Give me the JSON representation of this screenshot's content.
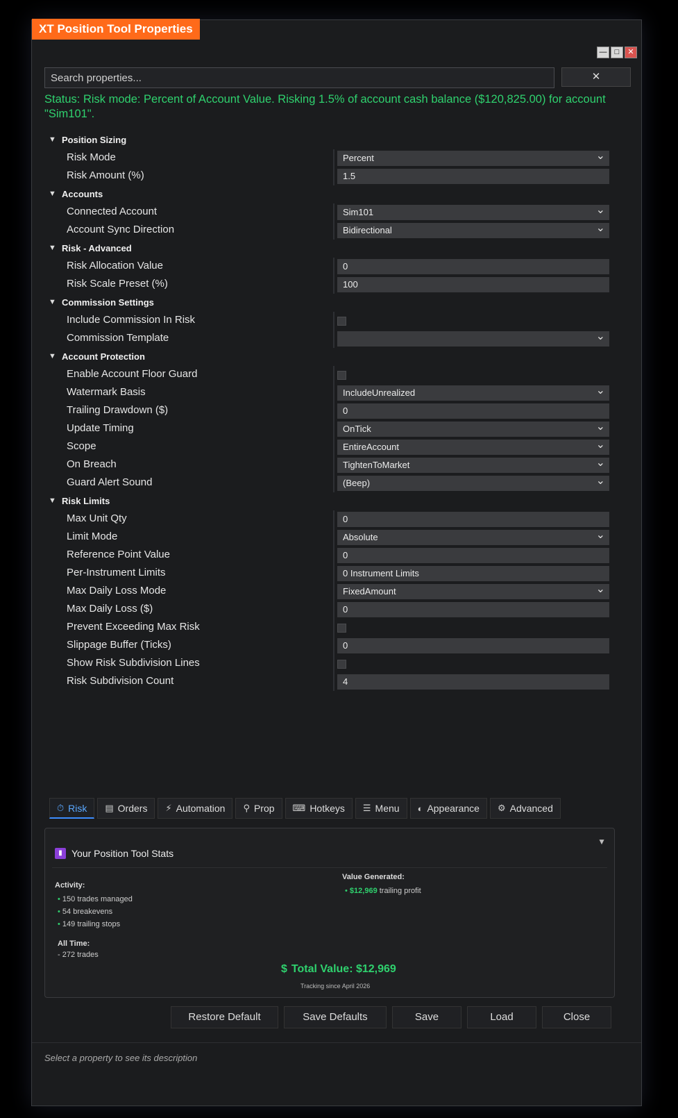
{
  "window": {
    "title": "XT Position Tool Properties",
    "controls": [
      "—",
      "□",
      "✕"
    ]
  },
  "search": {
    "placeholder": "Search properties...",
    "clear": "✕"
  },
  "status": "Status: Risk mode: Percent of Account Value. Risking 1.5% of account cash balance ($120,825.00) for account \"Sim101\".",
  "categories": [
    {
      "name": "Position Sizing",
      "props": [
        {
          "label": "Risk Mode",
          "value": "Percent",
          "kind": "dropdown"
        },
        {
          "label": "Risk Amount (%)",
          "value": "1.5",
          "kind": "text"
        }
      ]
    },
    {
      "name": "Accounts",
      "props": [
        {
          "label": "Connected Account",
          "value": "Sim101",
          "kind": "dropdown"
        },
        {
          "label": "Account Sync Direction",
          "value": "Bidirectional",
          "kind": "dropdown"
        }
      ]
    },
    {
      "name": "Risk - Advanced",
      "props": [
        {
          "label": "Risk Allocation Value",
          "value": "0",
          "kind": "text"
        },
        {
          "label": "Risk Scale Preset (%)",
          "value": "100",
          "kind": "text"
        }
      ]
    },
    {
      "name": "Commission Settings",
      "props": [
        {
          "label": "Include Commission In Risk",
          "value": "",
          "kind": "checkbox"
        },
        {
          "label": "Commission Template",
          "value": "",
          "kind": "dropdown"
        }
      ]
    },
    {
      "name": "Account Protection",
      "props": [
        {
          "label": "Enable Account Floor Guard",
          "value": "",
          "kind": "checkbox"
        },
        {
          "label": "Watermark Basis",
          "value": "IncludeUnrealized",
          "kind": "dropdown"
        },
        {
          "label": "Trailing Drawdown ($)",
          "value": "0",
          "kind": "text"
        },
        {
          "label": "Update Timing",
          "value": "OnTick",
          "kind": "dropdown"
        },
        {
          "label": "Scope",
          "value": "EntireAccount",
          "kind": "dropdown"
        },
        {
          "label": "On Breach",
          "value": "TightenToMarket",
          "kind": "dropdown"
        },
        {
          "label": "Guard Alert Sound",
          "value": "(Beep)",
          "kind": "dropdown"
        }
      ]
    },
    {
      "name": "Risk Limits",
      "props": [
        {
          "label": "Max Unit Qty",
          "value": "0",
          "kind": "text"
        },
        {
          "label": "Limit Mode",
          "value": "Absolute",
          "kind": "dropdown"
        },
        {
          "label": "Reference Point Value",
          "value": "0",
          "kind": "text"
        },
        {
          "label": "Per-Instrument Limits",
          "value": "0 Instrument Limits",
          "kind": "text"
        },
        {
          "label": "Max Daily Loss Mode",
          "value": "FixedAmount",
          "kind": "dropdown"
        },
        {
          "label": "Max Daily Loss ($)",
          "value": "0",
          "kind": "text"
        },
        {
          "label": "Prevent Exceeding Max Risk",
          "value": "",
          "kind": "checkbox"
        },
        {
          "label": "Slippage Buffer (Ticks)",
          "value": "0",
          "kind": "text"
        },
        {
          "label": "Show Risk Subdivision Lines",
          "value": "",
          "kind": "checkbox"
        },
        {
          "label": "Risk Subdivision Count",
          "value": "4",
          "kind": "text"
        }
      ]
    }
  ],
  "tabs": [
    {
      "label": "Risk",
      "icon": "⏱",
      "icon_name": "stopwatch-icon",
      "active": true
    },
    {
      "label": "Orders",
      "icon": "▤",
      "icon_name": "clipboard-icon",
      "active": false
    },
    {
      "label": "Automation",
      "icon": "⚡",
      "icon_name": "lightning-icon",
      "active": false
    },
    {
      "label": "Prop",
      "icon": "⚲",
      "icon_name": "user-icon",
      "active": false
    },
    {
      "label": "Hotkeys",
      "icon": "⌨",
      "icon_name": "keyboard-icon",
      "active": false
    },
    {
      "label": "Menu",
      "icon": "☰",
      "icon_name": "menu-icon",
      "active": false
    },
    {
      "label": "Appearance",
      "icon": "◐",
      "icon_name": "palette-icon",
      "active": false
    },
    {
      "label": "Advanced",
      "icon": "⚙",
      "icon_name": "gear-icon",
      "active": false
    }
  ],
  "stats": {
    "title": "Your Position Tool Stats",
    "collapse": "▼",
    "activity_head": "Activity:",
    "activity": [
      "150 trades managed",
      "54 breakevens",
      "149 trailing stops"
    ],
    "alltime_head": "All Time:",
    "alltime": "- 272 trades",
    "value_head": "Value Generated:",
    "value_amount": "$12,969",
    "value_text": " trailing profit",
    "total": "Total Value: $12,969",
    "tracking": "Tracking since April 2026"
  },
  "actions": [
    "Restore Default",
    "Save Defaults",
    "Save",
    "Load",
    "Close"
  ],
  "hint": "Select a property to see its description"
}
